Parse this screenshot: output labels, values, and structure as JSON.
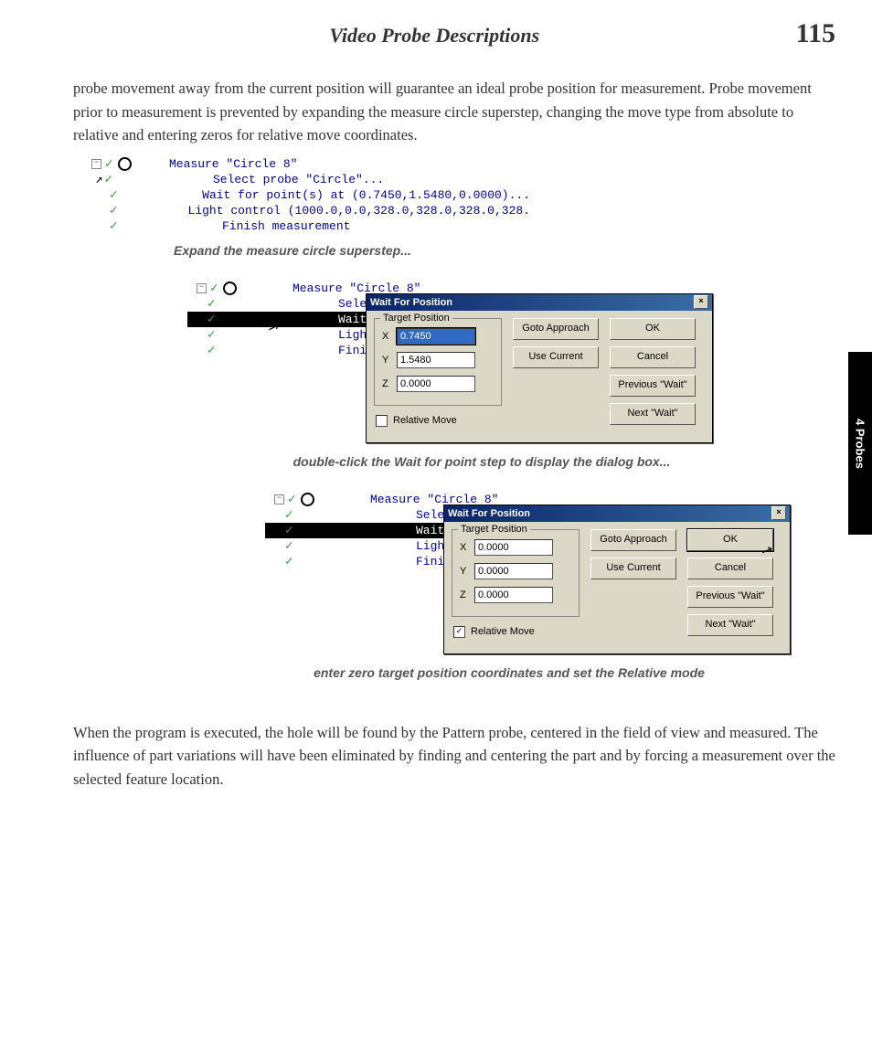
{
  "header": {
    "title": "Video Probe Descriptions",
    "pageNumber": "115"
  },
  "tab": "4  Probes",
  "para1": "probe movement away from the current position will guarantee an ideal probe position for measurement. Probe movement prior to measurement is prevented by expanding the measure circle superstep, changing the move type from absolute to relative and entering zeros for relative move coordinates.",
  "tree1": {
    "l0": "Measure \"Circle 8\"",
    "l1": "Select probe \"Circle\"...",
    "l2": "Wait for point(s) at (0.7450,1.5480,0.0000)...",
    "l3": "Light control (1000.0,0.0,328.0,328.0,328.0,328.",
    "l4": "Finish measurement"
  },
  "caption1": "Expand the measure circle superstep...",
  "tree2": {
    "l0": "Measure \"Circle 8\"",
    "l1": "Select pr",
    "l2": "Wait for ",
    "l3": "Light con",
    "l4": "Finish me"
  },
  "dialog": {
    "title": "Wait For Position",
    "group": "Target Position",
    "xLabel": "X",
    "yLabel": "Y",
    "zLabel": "Z",
    "relMove": "Relative Move",
    "gotoApproach": "Goto Approach",
    "useCurrent": "Use Current",
    "ok": "OK",
    "cancel": "Cancel",
    "prevWait": "Previous \"Wait\"",
    "nextWait": "Next \"Wait\""
  },
  "dlg2": {
    "x": "0.7450",
    "y": "1.5480",
    "z": "0.0000",
    "relChecked": false
  },
  "caption2": "double-click the Wait for point step to display the dialog box...",
  "tree3": {
    "l0": "Measure \"Circle 8\"",
    "l1": "Select pr",
    "l2": "Wait for ",
    "l3": "Light con",
    "l4": "Finish me"
  },
  "dlg3": {
    "x": "0.0000",
    "y": "0.0000",
    "z": "0.0000",
    "relChecked": true
  },
  "caption3": "enter zero target position coordinates and set the Relative mode",
  "para2": "When the program is executed, the hole will be found by the Pattern probe, centered in the field of view and measured.  The influence of part variations will have been eliminated by finding and centering the part and by forcing a measurement over the selected feature location."
}
